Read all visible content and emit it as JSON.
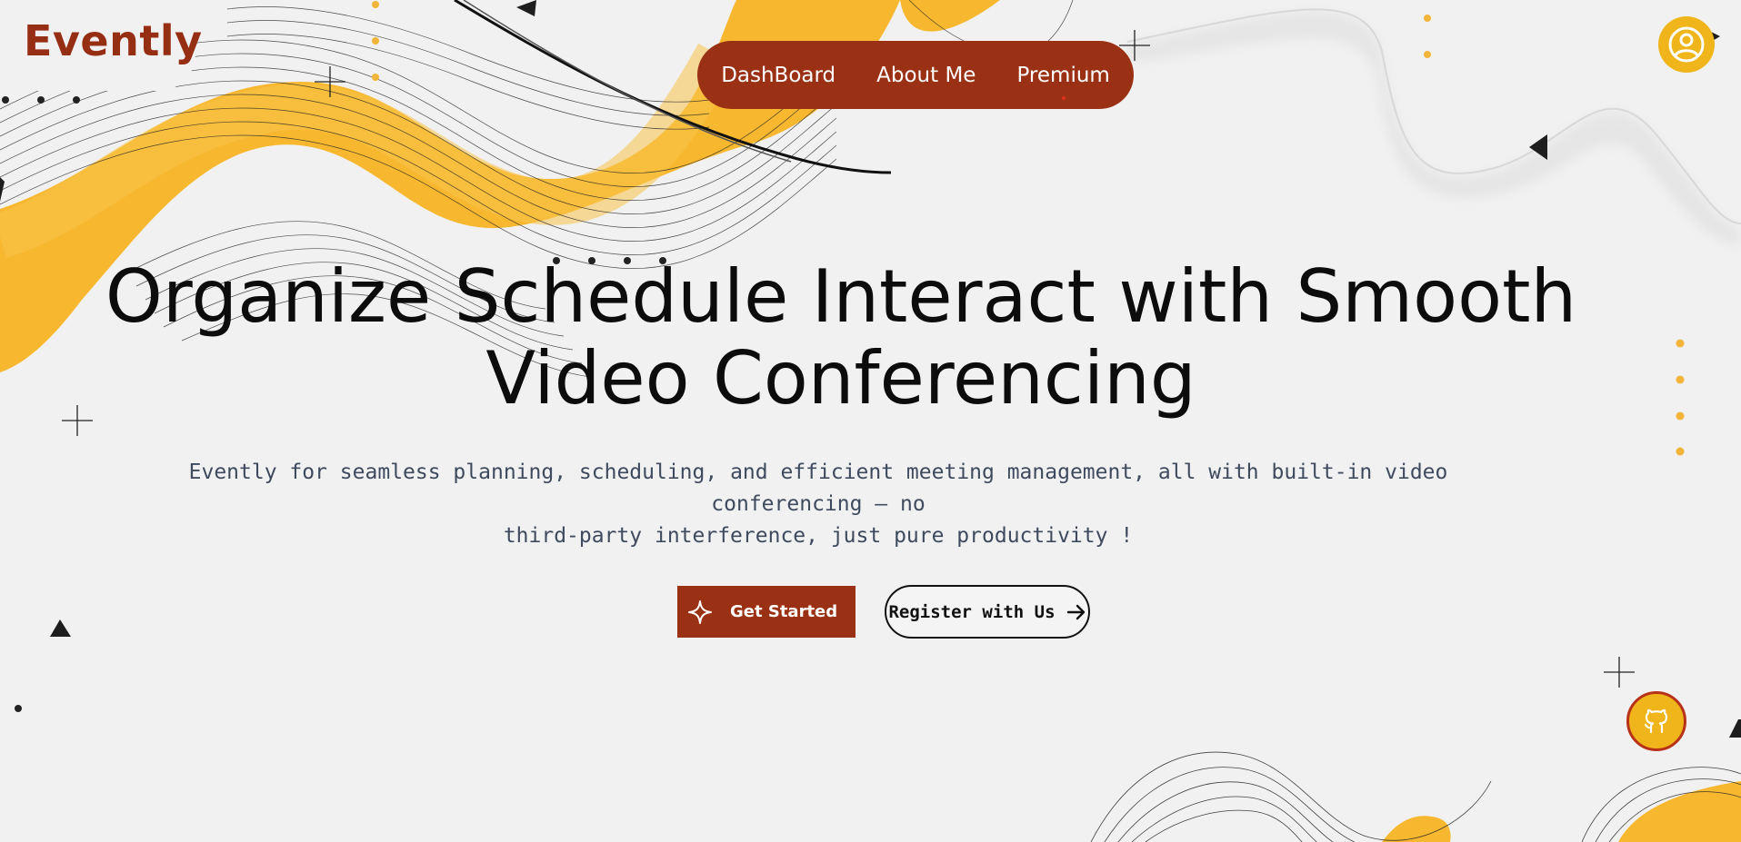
{
  "brand": {
    "name": "Evently",
    "color": "#962e14"
  },
  "nav": {
    "items": [
      {
        "label": "DashBoard"
      },
      {
        "label": "About Me"
      },
      {
        "label": "Premium"
      }
    ],
    "background": "#9a3114"
  },
  "header": {
    "profile_icon": "user-circle-icon"
  },
  "hero": {
    "title_line1": "Organize Schedule Interact with Smooth",
    "title_line2": "Video Conferencing",
    "subtitle_line1": "Evently for seamless planning, scheduling, and efficient meeting management, all with built-in video conferencing – no",
    "subtitle_line2": "third-party interference, just pure productivity !"
  },
  "actions": {
    "primary_label": "Get Started",
    "primary_icon": "sparkle-icon",
    "secondary_label": "Register with Us",
    "secondary_icon": "arrow-right-icon"
  },
  "floating": {
    "github_icon": "github-icon"
  },
  "colors": {
    "accent": "#9a3114",
    "yellow": "#f0b51a",
    "background": "#f1f1f1"
  }
}
